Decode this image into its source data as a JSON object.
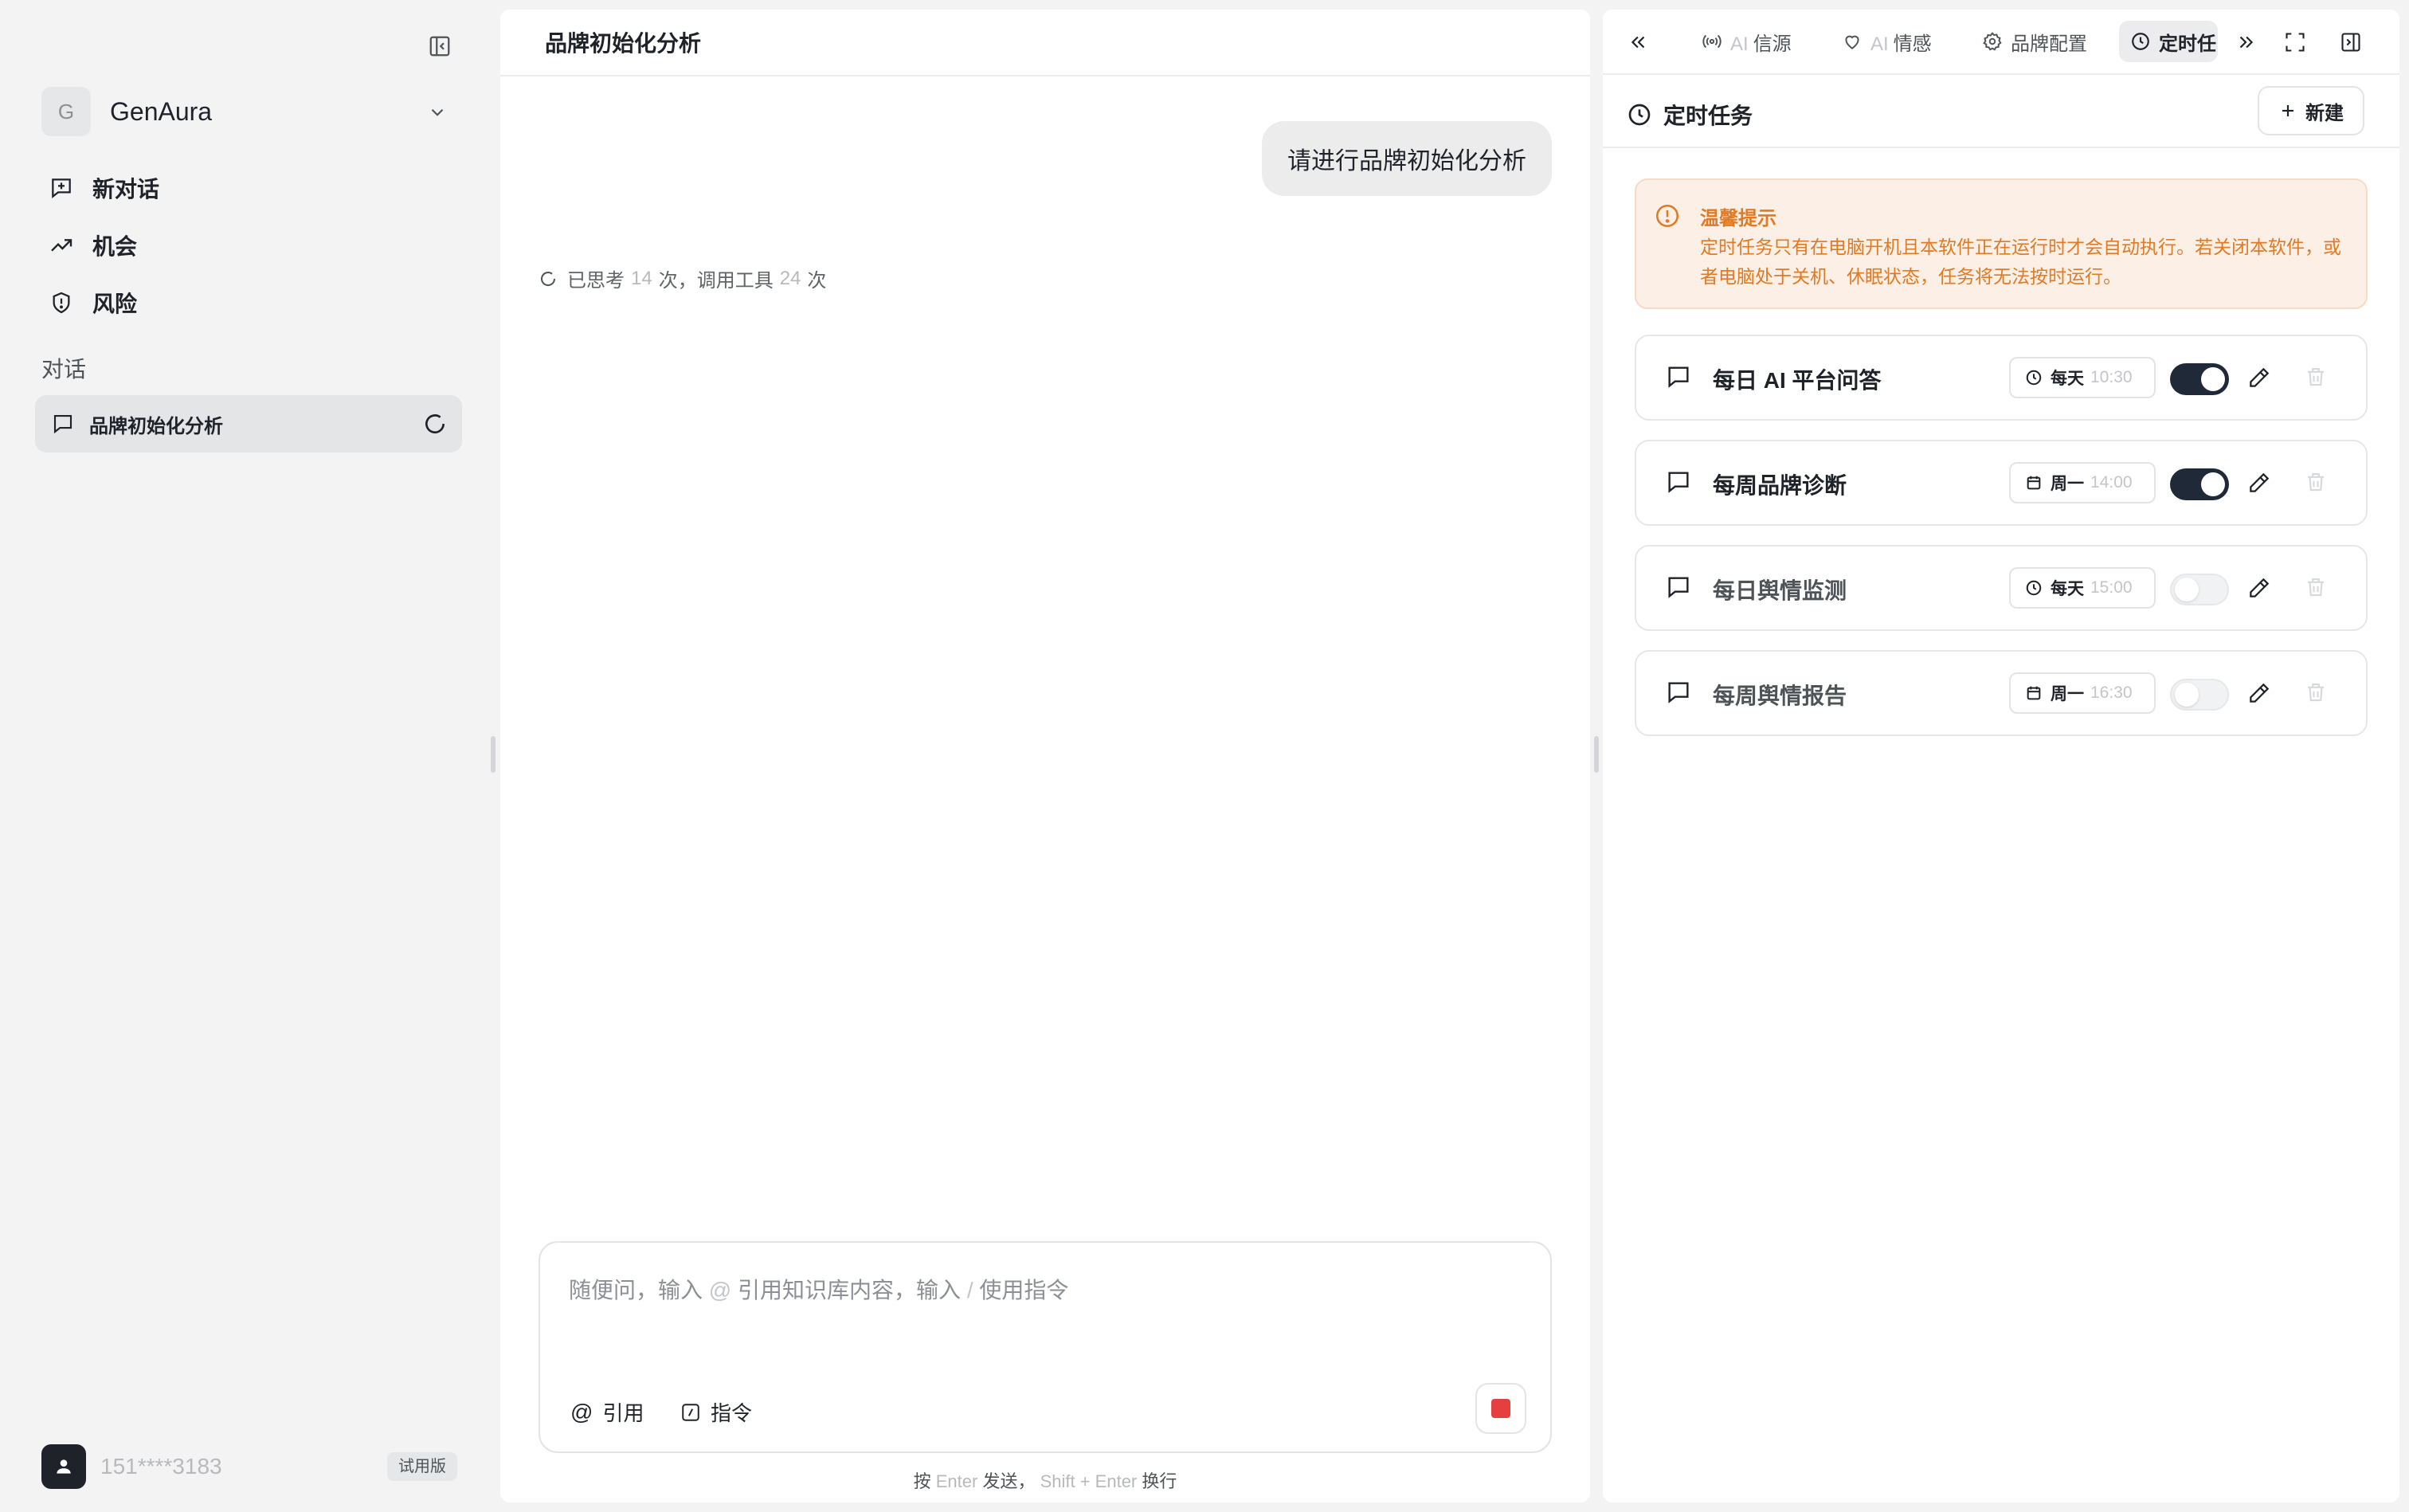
{
  "sidebar": {
    "workspace": {
      "initial": "G",
      "name": "GenAura"
    },
    "nav": [
      {
        "label": "新对话",
        "icon": "new-chat-icon"
      },
      {
        "label": "机会",
        "icon": "trending-up-icon"
      },
      {
        "label": "风险",
        "icon": "shield-icon"
      }
    ],
    "section_label": "对话",
    "conversation": {
      "label": "品牌初始化分析"
    },
    "user": {
      "phone": "151****3183",
      "badge": "试用版"
    }
  },
  "chat": {
    "title": "品牌初始化分析",
    "user_message": "请进行品牌初始化分析",
    "thinking": {
      "prefix": "已思考",
      "think_count": "14",
      "middle": "次，调用工具",
      "tool_count": "24",
      "suffix": "次"
    },
    "composer": {
      "placeholder_a": "随便问，输入",
      "at": "@",
      "placeholder_b": "引用知识库内容，输入",
      "slash": "/",
      "placeholder_c": "使用指令",
      "quote_label": "引用",
      "command_label": "指令"
    },
    "hint": {
      "a": "按",
      "enter": "Enter",
      "b": "发送，",
      "shift_enter": "Shift + Enter",
      "c": "换行"
    }
  },
  "panel": {
    "tabs": [
      {
        "prefix": "AI",
        "label": "信源",
        "icon": "broadcast-icon"
      },
      {
        "prefix": "AI",
        "label": "情感",
        "icon": "heart-icon"
      },
      {
        "prefix": "",
        "label": "品牌配置",
        "icon": "gear-icon"
      },
      {
        "prefix": "",
        "label": "定时任",
        "icon": "clock-icon"
      }
    ],
    "section_title": "定时任务",
    "new_label": "新建",
    "notice": {
      "title": "温馨提示",
      "body": "定时任务只有在电脑开机且本软件正在运行时才会自动执行。若关闭本软件，或者电脑处于关机、休眠状态，任务将无法按时运行。"
    },
    "tasks": [
      {
        "name": "每日 AI 平台问答",
        "freq": "每天",
        "time": "10:30",
        "enabled": true
      },
      {
        "name": "每周品牌诊断",
        "freq": "周一",
        "time": "14:00",
        "enabled": true
      },
      {
        "name": "每日舆情监测",
        "freq": "每天",
        "time": "15:00",
        "enabled": false
      },
      {
        "name": "每周舆情报告",
        "freq": "周一",
        "time": "16:30",
        "enabled": false
      }
    ]
  },
  "colors": {
    "accent": "#1f2937",
    "warning": "#e07a24",
    "warning_bg": "#fcefe5",
    "stop": "#e5403f"
  }
}
